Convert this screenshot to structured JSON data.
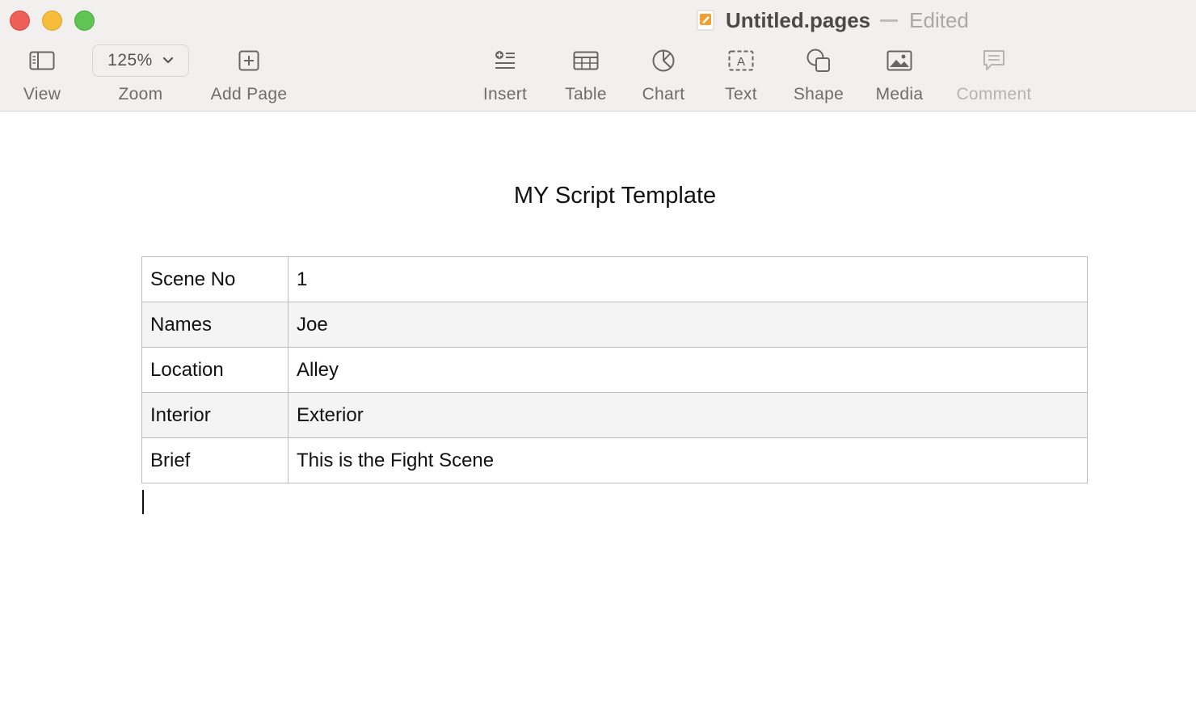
{
  "window": {
    "document_title": "Untitled.pages",
    "status": "Edited"
  },
  "toolbar": {
    "view_label": "View",
    "zoom_label": "Zoom",
    "zoom_value": "125%",
    "add_page_label": "Add Page",
    "insert_label": "Insert",
    "table_label": "Table",
    "chart_label": "Chart",
    "text_label": "Text",
    "shape_label": "Shape",
    "media_label": "Media",
    "comment_label": "Comment"
  },
  "document": {
    "heading": "MY Script Template",
    "rows": [
      {
        "key": "Scene No",
        "value": "1"
      },
      {
        "key": "Names",
        "value": "Joe"
      },
      {
        "key": "Location",
        "value": "Alley"
      },
      {
        "key": "Interior",
        "value": "Exterior"
      },
      {
        "key": "Brief",
        "value": "This is the Fight Scene"
      }
    ]
  },
  "icons": {
    "view": "sidebar-icon",
    "zoom": "chevron-down-icon",
    "add_page": "plus-square-icon",
    "insert": "insert-list-icon",
    "table": "table-icon",
    "chart": "pie-chart-icon",
    "text": "text-box-icon",
    "shape": "shape-icon",
    "media": "image-icon",
    "comment": "comment-icon"
  },
  "colors": {
    "close": "#ee5f57",
    "minimize": "#f6bd3b",
    "zoom": "#5fc453",
    "toolbar_bg": "#f1f0ef",
    "pages_icon": "#f0a030"
  }
}
